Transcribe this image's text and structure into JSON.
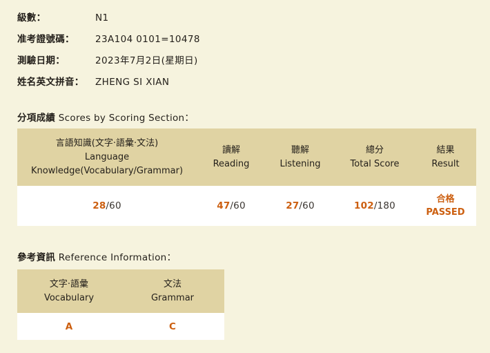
{
  "candidate_info": {
    "rows": [
      {
        "label": "級數：",
        "value": "N1"
      },
      {
        "label": "准考證號碼：",
        "value": "23A104 0101=10478"
      },
      {
        "label": "測驗日期：",
        "value": "2023年7月2日(星期日)"
      },
      {
        "label": "姓名英文拼音：",
        "value": "ZHENG SI XIAN"
      }
    ]
  },
  "scores_section": {
    "heading_cjk": "分項成績",
    "heading_latin": " Scores by Scoring Section：",
    "columns": [
      {
        "cjk": "言語知識(文字·語彙·文法)",
        "latin_line1": "Language",
        "latin_line2": "Knowledge(Vocabulary/Grammar)"
      },
      {
        "cjk": "讀解",
        "latin_line1": "Reading",
        "latin_line2": ""
      },
      {
        "cjk": "聽解",
        "latin_line1": "Listening",
        "latin_line2": ""
      },
      {
        "cjk": "總分",
        "latin_line1": "Total Score",
        "latin_line2": ""
      },
      {
        "cjk": "結果",
        "latin_line1": "Result",
        "latin_line2": ""
      }
    ],
    "values": {
      "language_knowledge": {
        "score": "28",
        "separator": "/",
        "max": "60"
      },
      "reading": {
        "score": "47",
        "separator": "/",
        "max": "60"
      },
      "listening": {
        "score": "27",
        "separator": "/",
        "max": "60"
      },
      "total": {
        "score": "102",
        "separator": "/",
        "max": "180"
      },
      "result": {
        "cjk": "合格",
        "latin": "PASSED"
      }
    }
  },
  "reference_section": {
    "heading_cjk": "參考資訊",
    "heading_latin": " Reference Information：",
    "columns": [
      {
        "cjk": "文字·語彙",
        "latin": "Vocabulary"
      },
      {
        "cjk": "文法",
        "latin": "Grammar"
      }
    ],
    "values": {
      "vocabulary": "A",
      "grammar": "C"
    }
  },
  "colors": {
    "page_background": "#f6f3de",
    "table_header_background": "#e0d3a3",
    "table_body_background": "#ffffff",
    "accent": "#cc5f10",
    "text": "#231f1a"
  }
}
